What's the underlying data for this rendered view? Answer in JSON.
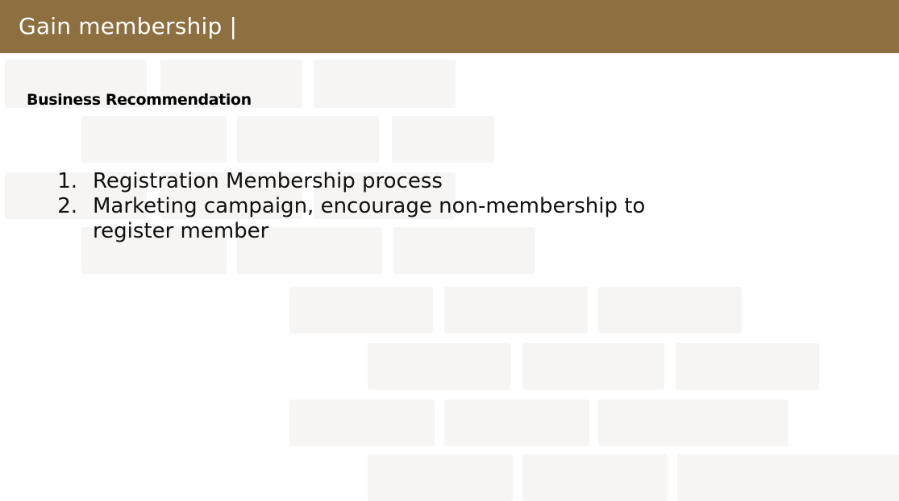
{
  "header": {
    "title": "Gain membership |"
  },
  "section": {
    "heading": "Business Recommendation"
  },
  "recommendations": [
    {
      "number": "1.",
      "text": "Registration Membership process"
    },
    {
      "number": "2.",
      "text": "Marketing campaign, encourage non-membership to register member"
    }
  ],
  "colors": {
    "header_bg": "#8d6f40",
    "header_text": "#ffffff",
    "brick": "#f6f5f3"
  }
}
